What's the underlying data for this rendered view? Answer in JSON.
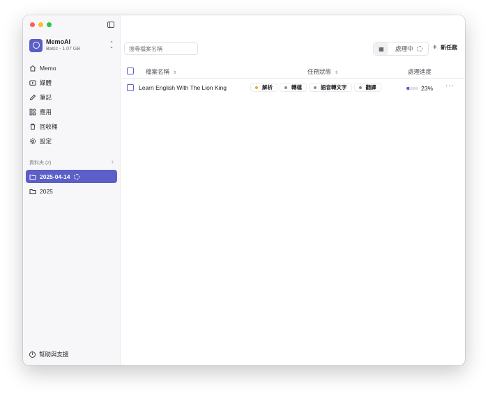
{
  "sidebar": {
    "account": {
      "name": "MemoAI",
      "plan": "Basic - 1.07 GB"
    },
    "nav_items": [
      {
        "label": "Memo",
        "icon": "home-icon"
      },
      {
        "label": "媒體",
        "icon": "media-icon"
      },
      {
        "label": "筆記",
        "icon": "pencil-icon"
      },
      {
        "label": "應用",
        "icon": "apps-icon"
      },
      {
        "label": "回收桶",
        "icon": "trash-icon"
      },
      {
        "label": "設定",
        "icon": "gear-icon"
      }
    ],
    "folders_header": "資料夾 (2)",
    "folders": [
      {
        "label": "2025-04-14",
        "active": true,
        "processing": true
      },
      {
        "label": "2025",
        "active": false,
        "processing": false
      }
    ],
    "help_label": "幫助與支援"
  },
  "toolbar": {
    "search_placeholder": "搜尋檔案名稱",
    "processing_label": "處理中",
    "new_task_label": "新任務"
  },
  "table": {
    "columns": {
      "name": "檔案名稱",
      "status": "任務狀態",
      "progress": "處理進度"
    },
    "rows": [
      {
        "name": "Learn English With The Lion King",
        "tags": [
          {
            "label": "解析",
            "color": "#f5a623"
          },
          {
            "label": "轉檔",
            "color": "#8a8a92"
          },
          {
            "label": "語音轉文字",
            "color": "#8a8a92"
          },
          {
            "label": "翻譯",
            "color": "#8a8a92"
          }
        ],
        "progress": 23,
        "progress_label": "23%"
      }
    ]
  },
  "colors": {
    "accent": "#5b5fc7"
  }
}
